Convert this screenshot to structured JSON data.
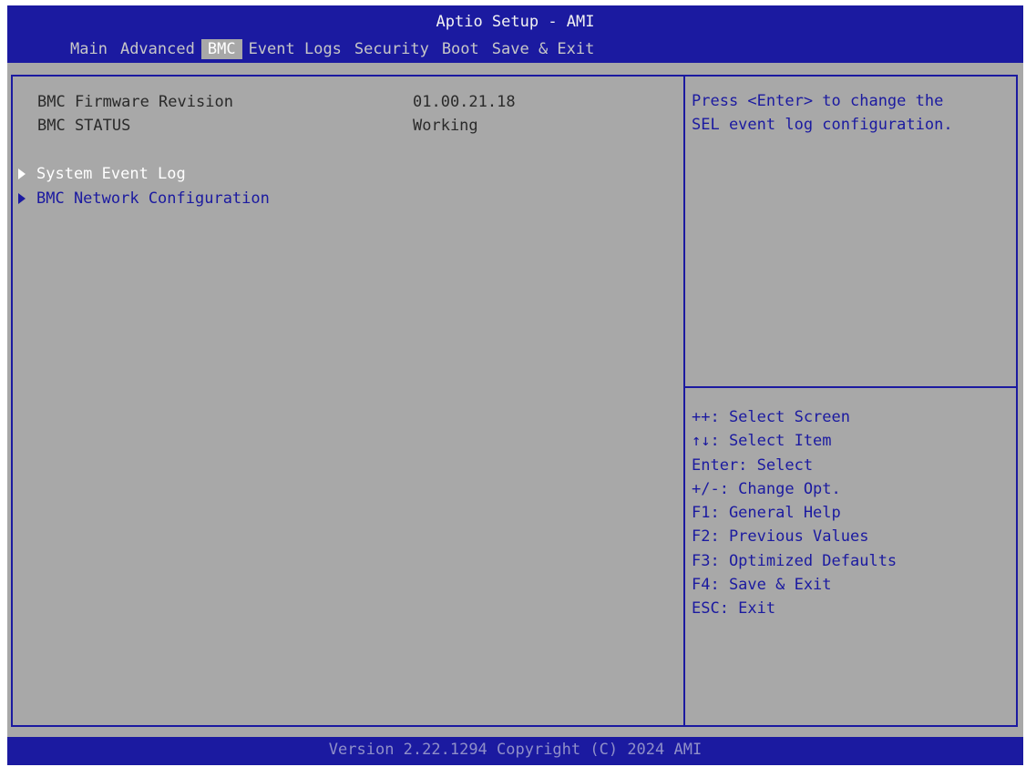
{
  "title": "Aptio Setup - AMI",
  "menu": {
    "tabs": [
      {
        "label": "Main",
        "active": false
      },
      {
        "label": "Advanced",
        "active": false
      },
      {
        "label": "BMC",
        "active": true
      },
      {
        "label": "Event Logs",
        "active": false
      },
      {
        "label": "Security",
        "active": false
      },
      {
        "label": "Boot",
        "active": false
      },
      {
        "label": "Save & Exit",
        "active": false
      }
    ]
  },
  "info": [
    {
      "label": "BMC Firmware Revision",
      "value": "01.00.21.18"
    },
    {
      "label": "BMC STATUS",
      "value": "Working"
    }
  ],
  "submenus": [
    {
      "label": "System Event Log",
      "selected": true
    },
    {
      "label": "BMC Network Configuration",
      "selected": false
    }
  ],
  "help": {
    "lines": [
      "Press <Enter> to change the",
      "SEL event log configuration."
    ]
  },
  "keys": [
    "++: Select Screen",
    "↑↓: Select Item",
    "Enter: Select",
    "+/-: Change Opt.",
    "F1: General Help",
    "F2: Previous Values",
    "F3: Optimized Defaults",
    "F4: Save & Exit",
    "ESC: Exit"
  ],
  "footer": "Version 2.22.1294 Copyright (C) 2024 AMI",
  "colors": {
    "frame_blue": "#1b1aa0",
    "panel_gray": "#a8a8a8",
    "selected_text": "#ffffff"
  },
  "icons": {
    "submenu_marker": "triangle-right-icon"
  }
}
